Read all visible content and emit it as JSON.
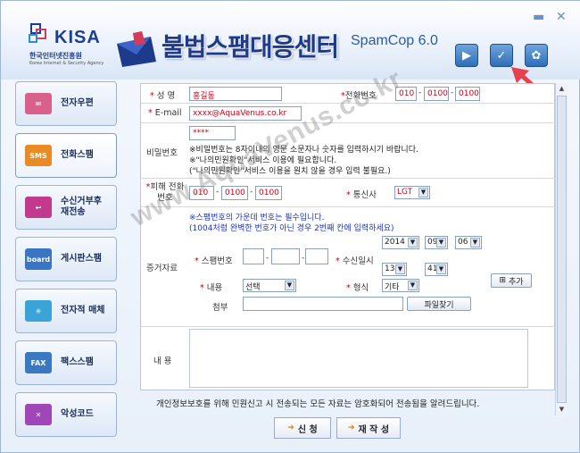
{
  "header": {
    "kisa_name": "KISA",
    "kisa_subtitle_ko": "한국인터넷진흥원",
    "kisa_subtitle_en": "Korea Internet & Security Agency",
    "app_title": "불법스팸대응센터",
    "app_version": "SpamCop 6.0"
  },
  "sidebar": {
    "items": [
      {
        "label": "전자우편",
        "icon": "email-icon",
        "color": "#d9608a"
      },
      {
        "label": "전화스팸",
        "icon": "phone-sms-icon",
        "color": "#e98a24"
      },
      {
        "label": "수신거부후\n재전송",
        "icon": "return-arrow-icon",
        "color": "#c23a8e"
      },
      {
        "label": "게시판스팸",
        "icon": "board-icon",
        "color": "#3a74c5"
      },
      {
        "label": "전자적 매체",
        "icon": "spark-icon",
        "color": "#3aa4d8"
      },
      {
        "label": "팩스스팸",
        "icon": "fax-icon",
        "color": "#3a78c2"
      },
      {
        "label": "악성코드",
        "icon": "document-x-icon",
        "color": "#a046b8"
      }
    ]
  },
  "form": {
    "name_label": "성  명",
    "name_value": "홍길동",
    "phone_label": "전화번호",
    "phone_parts": [
      "010",
      "0100",
      "0100"
    ],
    "email_label": "E-mail",
    "email_value": "xxxx@AquaVenus.co.kr",
    "password_label": "비밀번호",
    "password_value": "****",
    "password_note1": "※비밀번호는 8자이내의 영문 소문자나 숫자를 입력하시기 바랍니다.",
    "password_note2": "※\"나의민원확인\"서비스 이용에 필요합니다.",
    "password_note3": "(\"나의민원확인\"서비스 이용을 원치 않을 경우 입력 불필요.)",
    "victim_phone_label": "피해 전화번호",
    "victim_phone_parts": [
      "010",
      "0100",
      "0100"
    ],
    "carrier_label": "통신사",
    "carrier_value": "LGT",
    "evidence_label": "증거자료",
    "evidence_note1": "※스팸번호의 가운데 번호는 필수입니다.",
    "evidence_note2": "(1004처럼 완벽한 번호가 아닌 경우 2번째 칸에 입력하세요)",
    "spam_number_label": "스팸번호",
    "received_datetime_label": "수신일시",
    "year": "2014",
    "month": "09",
    "day": "06",
    "hour": "13",
    "minute": "41",
    "add_button": "추가",
    "content_label": "내용",
    "content_value": "선택",
    "format_label": "형식",
    "format_value": "기타",
    "attach_label": "첨부",
    "find_file_button": "파일찾기",
    "body_label": "내  용"
  },
  "footer": {
    "privacy_note": "개인정보보호를 위해 민원신고 시 전송되는 모든 자료는 암호화되어 전송됨을 알려드립니다.",
    "submit_button": "신 청",
    "rewrite_button": "재 작 성"
  },
  "watermark": "www.AquaVenus.co.kr"
}
